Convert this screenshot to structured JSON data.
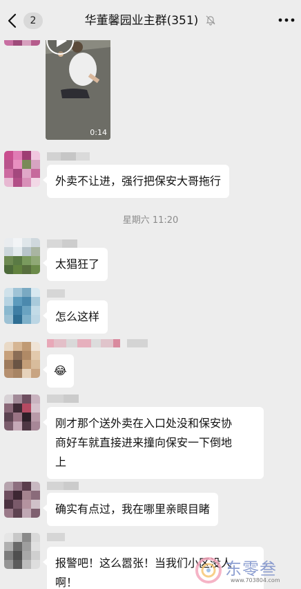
{
  "header": {
    "unread_count": "2",
    "title": "华董馨园业主群(351)"
  },
  "video": {
    "duration": "0:14"
  },
  "messages": [
    {
      "text": "外卖不让进，强行把保安大哥拖行"
    },
    {
      "text": "太猖狂了"
    },
    {
      "text": "怎么这样"
    },
    {
      "text": "😂"
    },
    {
      "text": "刚才那个送外卖在入口处没和保安协\n商好车就直接进来撞向保安一下倒地\n上"
    },
    {
      "text": "确实有点过，我在哪里亲眼目睹"
    },
    {
      "text": "报警吧！这么嚣张！当我们小区没人\n啊！"
    }
  ],
  "timestamp": "星期六 11:20",
  "watermark": {
    "brand": "东零叁",
    "url": "www.703804.com"
  }
}
